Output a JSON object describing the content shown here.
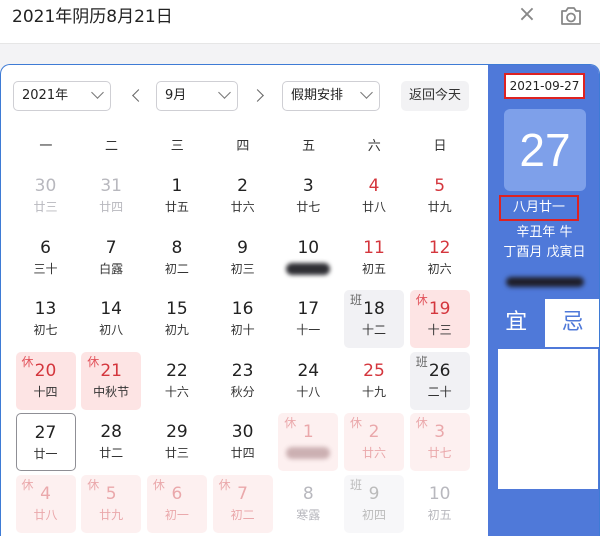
{
  "search": {
    "query": "2021年阴历8月21日",
    "clear_icon": "×"
  },
  "toolbar": {
    "year": "2021年",
    "month": "9月",
    "holiday": "假期安排",
    "today": "返回今天"
  },
  "weekdays": [
    "一",
    "二",
    "三",
    "四",
    "五",
    "六",
    "日"
  ],
  "days": [
    {
      "num": "30",
      "lunar": "廿三",
      "other": true
    },
    {
      "num": "31",
      "lunar": "廿四",
      "other": true
    },
    {
      "num": "1",
      "lunar": "廿五"
    },
    {
      "num": "2",
      "lunar": "廿六"
    },
    {
      "num": "3",
      "lunar": "廿七"
    },
    {
      "num": "4",
      "lunar": "廿八",
      "weekend": true
    },
    {
      "num": "5",
      "lunar": "廿九",
      "weekend": true
    },
    {
      "num": "6",
      "lunar": "三十"
    },
    {
      "num": "7",
      "lunar": "白露"
    },
    {
      "num": "8",
      "lunar": "初二"
    },
    {
      "num": "9",
      "lunar": "初三"
    },
    {
      "num": "10",
      "lunar": "",
      "smudge": true
    },
    {
      "num": "11",
      "lunar": "初五",
      "weekend": true
    },
    {
      "num": "12",
      "lunar": "初六",
      "weekend": true
    },
    {
      "num": "13",
      "lunar": "初七"
    },
    {
      "num": "14",
      "lunar": "初八"
    },
    {
      "num": "15",
      "lunar": "初九"
    },
    {
      "num": "16",
      "lunar": "初十"
    },
    {
      "num": "17",
      "lunar": "十一"
    },
    {
      "num": "18",
      "lunar": "十二",
      "tag": "班",
      "kind": "work"
    },
    {
      "num": "19",
      "lunar": "十三",
      "tag": "休",
      "kind": "rest"
    },
    {
      "num": "20",
      "lunar": "十四",
      "tag": "休",
      "kind": "rest"
    },
    {
      "num": "21",
      "lunar": "中秋节",
      "tag": "休",
      "kind": "rest"
    },
    {
      "num": "22",
      "lunar": "十六"
    },
    {
      "num": "23",
      "lunar": "秋分"
    },
    {
      "num": "24",
      "lunar": "十八"
    },
    {
      "num": "25",
      "lunar": "十九",
      "weekend": true
    },
    {
      "num": "26",
      "lunar": "二十",
      "tag": "班",
      "kind": "work"
    },
    {
      "num": "27",
      "lunar": "廿一",
      "selected": true
    },
    {
      "num": "28",
      "lunar": "廿二"
    },
    {
      "num": "29",
      "lunar": "廿三"
    },
    {
      "num": "30",
      "lunar": "廿四"
    },
    {
      "num": "1",
      "lunar": "",
      "tag": "休",
      "kind": "rest",
      "other": true,
      "smudge": true
    },
    {
      "num": "2",
      "lunar": "廿六",
      "tag": "休",
      "kind": "rest",
      "other": true
    },
    {
      "num": "3",
      "lunar": "廿七",
      "tag": "休",
      "kind": "rest",
      "other": true
    },
    {
      "num": "4",
      "lunar": "廿八",
      "tag": "休",
      "kind": "rest",
      "other": true
    },
    {
      "num": "5",
      "lunar": "廿九",
      "tag": "休",
      "kind": "rest",
      "other": true
    },
    {
      "num": "6",
      "lunar": "初一",
      "tag": "休",
      "kind": "rest",
      "other": true
    },
    {
      "num": "7",
      "lunar": "初二",
      "tag": "休",
      "kind": "rest",
      "other": true
    },
    {
      "num": "8",
      "lunar": "寒露",
      "other": true
    },
    {
      "num": "9",
      "lunar": "初四",
      "tag": "班",
      "kind": "work",
      "other": true
    },
    {
      "num": "10",
      "lunar": "初五",
      "other": true,
      "weekend": true
    }
  ],
  "panel": {
    "date": "2021-09-27",
    "day": "27",
    "lunar": "八月廿一",
    "ganzhi_year": "辛丑年 牛",
    "ganzhi_month_day": "丁酉月 戊寅日",
    "yi": "宜",
    "ji": "忌"
  },
  "colors": {
    "accent": "#4f79d9",
    "holiday_red": "#d4363d",
    "rest_bg": "#fde4e4",
    "work_bg": "#f1f1f4",
    "highlight_border": "#dd2222"
  }
}
